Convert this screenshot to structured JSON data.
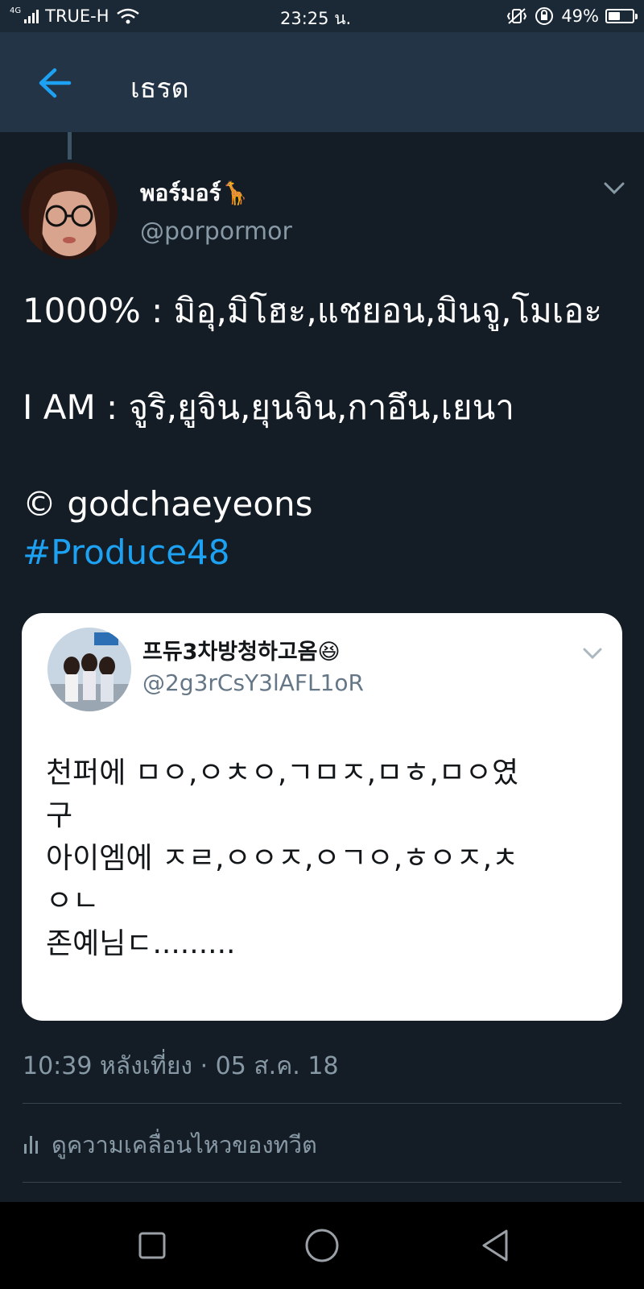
{
  "status_bar": {
    "network_tag": "4G",
    "carrier": "TRUE-H",
    "time": "23:25 น.",
    "battery_percent": "49%",
    "battery_level": 0.49
  },
  "header": {
    "title": "เธรด"
  },
  "tweet": {
    "display_name": "พอร์มอร์🦒",
    "handle": "@porpormor",
    "text_lines": [
      "1000% : มิอุ,มิโฮะ,แชยอน,มินจู,โมเอะ",
      "",
      "I AM : จูริ,ยูจิน,ยุนจิน,กาอึน,เยนา",
      "",
      "© godchaeyeons"
    ],
    "hashtag": "#Produce48",
    "timestamp": "10:39 หลังเที่ยง · 05 ส.ค. 18",
    "activity_label": "ดูความเคลื่อนไหวของทวีต"
  },
  "quoted_tweet": {
    "display_name": "프듀3차방청하고옴😆",
    "handle": "@2g3rCsY3lAFL1oR",
    "text_lines": [
      "천퍼에 ㅁㅇ,ㅇㅊㅇ,ㄱㅁㅈ,ㅁㅎ,ㅁㅇ였",
      "구",
      "아이엠에 ㅈㄹ,ㅇㅇㅈ,ㅇㄱㅇ,ㅎㅇㅈ,ㅊ",
      "ㅇㄴ",
      "존예님ㄷ........."
    ]
  },
  "colors": {
    "background": "#141d26",
    "header": "#243447",
    "accent": "#1da1f2",
    "secondary_text": "#8899a6"
  }
}
